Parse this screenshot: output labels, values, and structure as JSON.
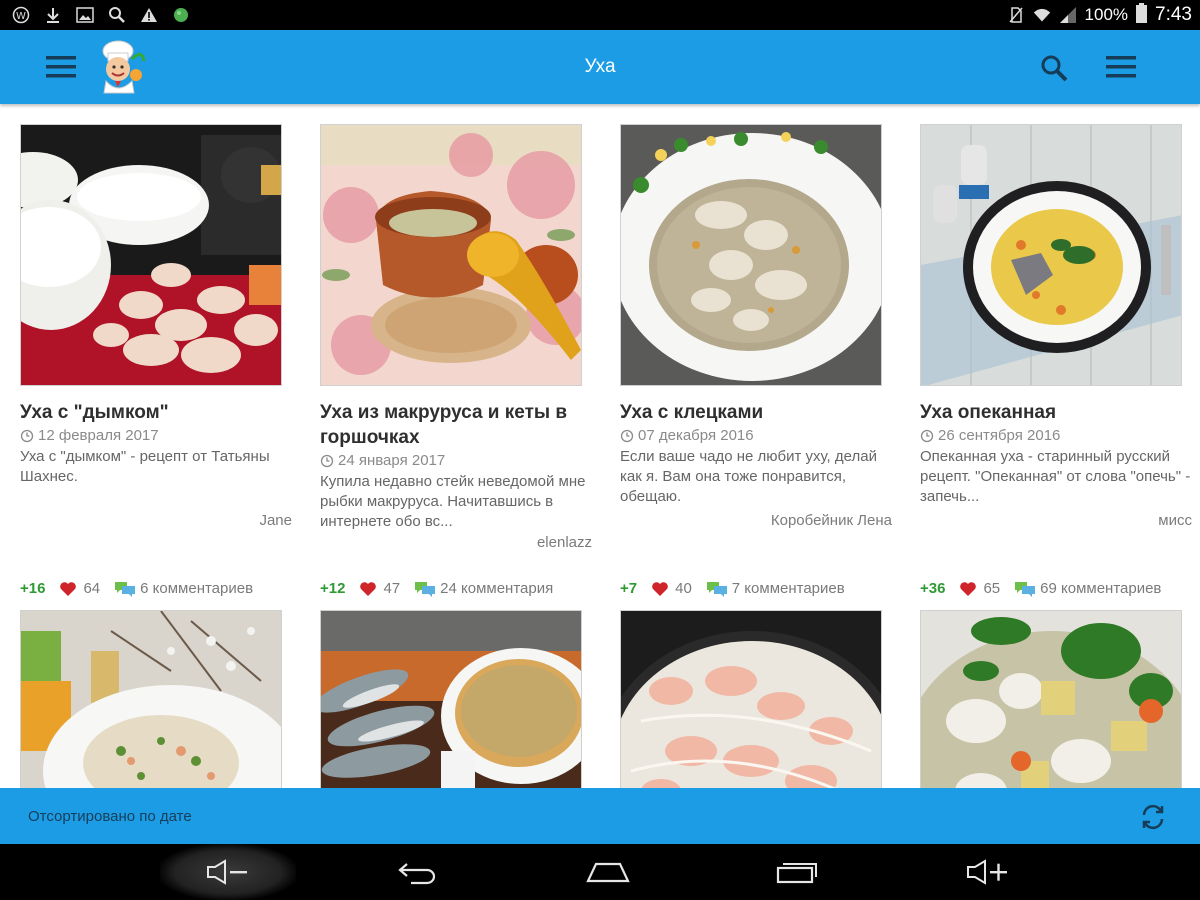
{
  "status_bar": {
    "icons_left": [
      "wordpress-icon",
      "download-icon",
      "image-icon",
      "search-icon",
      "warning-icon",
      "android-icon"
    ],
    "icons_right": [
      "no-sim-icon",
      "wifi-icon",
      "signal-icon"
    ],
    "battery": "100%",
    "time": "7:43"
  },
  "app_bar": {
    "title": "Уха",
    "icons": [
      "menu-icon",
      "chef-logo-icon",
      "search-icon",
      "overflow-menu-icon"
    ]
  },
  "recipes": [
    {
      "title": "Уха с \"дымком\"",
      "date": "12 февраля 2017",
      "description": "Уха с \"дымком\" - рецепт от Татьяны Шахнес.",
      "author": "Jane",
      "score": "+16",
      "likes": "64",
      "comments": "6 комментариев"
    },
    {
      "title": "Уха из макруруса и кеты в горшочках",
      "date": "24 января 2017",
      "description": "Купила недавно стейк неведомой мне рыбки макруруса. Начитавшись в интернете обо вс...",
      "author": "elenlazz",
      "score": "+12",
      "likes": "47",
      "comments": "24 комментария"
    },
    {
      "title": "Уха с клецками",
      "date": "07 декабря 2016",
      "description": "Если ваше чадо не любит уху, делай как я. Вам она тоже понравится, обещаю.",
      "author": "Коробейник Лена",
      "score": "+7",
      "likes": "40",
      "comments": "7 комментариев"
    },
    {
      "title": "Уха опеканная",
      "date": "26 сентября 2016",
      "description": "Опеканная уха - старинный русский рецепт. \"Опеканная\" от слова \"опечь\" - запечь...",
      "author": "мисс",
      "score": "+36",
      "likes": "65",
      "comments": "69 комментариев"
    }
  ],
  "second_row_photos": [
    "soup-bowl-flowers-photo",
    "fish-and-broth-photo",
    "salmon-soup-pot-photo",
    "fish-vegetable-soup-photo"
  ],
  "sort_bar": {
    "label": "Отсортировано по дате",
    "icon": "refresh-icon"
  },
  "nav_bar": {
    "icons": [
      "volume-down-icon",
      "back-icon",
      "home-icon",
      "recents-icon",
      "volume-up-icon"
    ]
  },
  "colors": {
    "accent": "#1b9ce5",
    "score_green": "#2f9a33",
    "heart_red": "#d0242b"
  }
}
